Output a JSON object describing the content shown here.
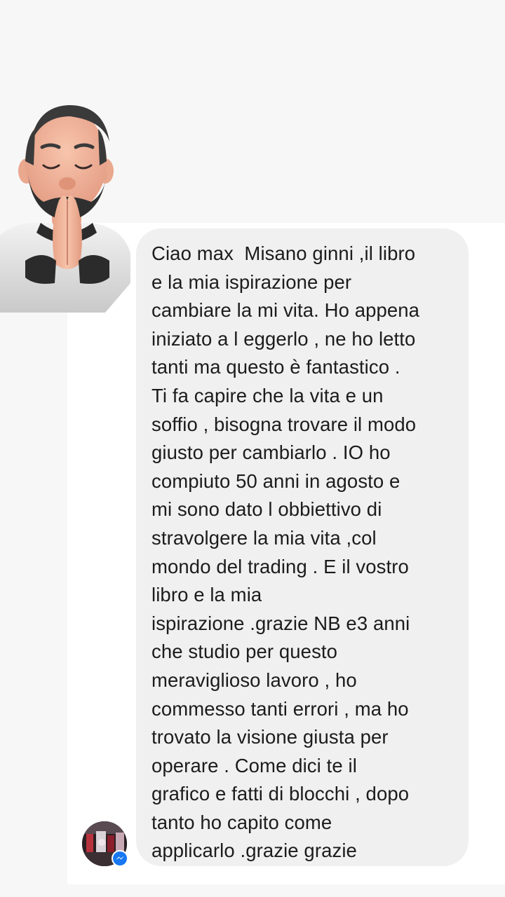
{
  "conversation": {
    "message": {
      "text": "Ciao max  Misano ginni ,il libro\ne la mia ispirazione per\ncambiare la mi vita. Ho appena\niniziato a l eggerlo , ne ho letto\ntanti ma questo è fantastico .\nTi fa capire che la vita e un\nsoffio , bisogna trovare il modo\ngiusto per cambiarlo . IO ho\ncompiuto 50 anni in agosto e\nmi sono dato l obbiettivo di\nstravolgere la mia vita ,col\nmondo del trading . E il vostro\nlibro e la mia\nispirazione .grazie NB e3 anni\nche studio per questo\nmeraviglioso lavoro , ho\ncommesso tanti errori , ma ho\ntrovato la visione giusta per\noperare . Come dici te il\ngrafico e fatti di blocchi , dopo\ntanto ho capito come\napplicarlo .grazie grazie"
    },
    "sender": {
      "avatar_icon": "profile-photo",
      "badge_icon": "messenger-icon"
    },
    "decoration": {
      "sticker_icon": "memoji-praying-hands-icon"
    }
  },
  "colors": {
    "page_background": "#f7f7f7",
    "chat_background": "#ffffff",
    "bubble_background": "#f0f0f0",
    "text": "#1c1c1c",
    "messenger_blue": "#1877f2"
  }
}
